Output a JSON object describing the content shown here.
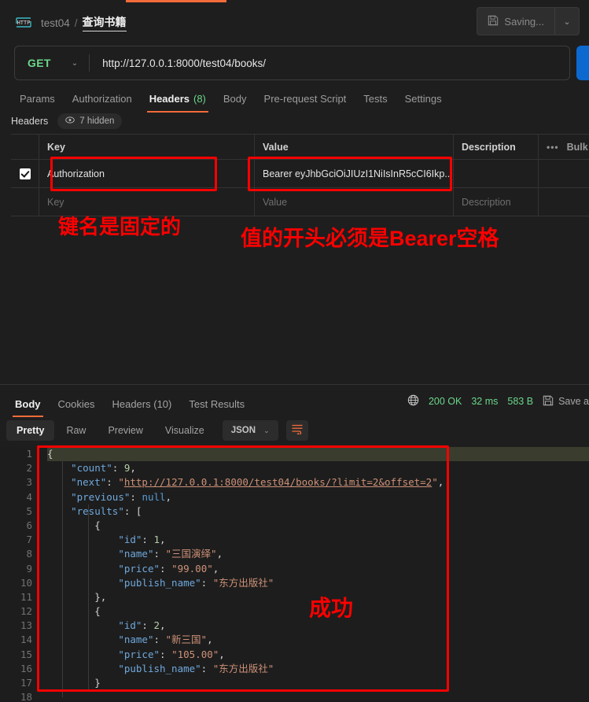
{
  "breadcrumb": {
    "icon": "http-icon",
    "project": "test04",
    "separator": "/",
    "request_name": "查询书籍"
  },
  "save": {
    "icon": "save-disk-icon",
    "label": "Saving...",
    "caret": "⌄"
  },
  "url_bar": {
    "method": "GET",
    "method_caret": "⌄",
    "url": "http://127.0.0.1:8000/test04/books/",
    "send_label": ""
  },
  "request_tabs": [
    {
      "label": "Params",
      "count": "",
      "active": false
    },
    {
      "label": "Authorization",
      "count": "",
      "active": false
    },
    {
      "label": "Headers",
      "count": "(8)",
      "active": true
    },
    {
      "label": "Body",
      "count": "",
      "active": false
    },
    {
      "label": "Pre-request Script",
      "count": "",
      "active": false
    },
    {
      "label": "Tests",
      "count": "",
      "active": false
    },
    {
      "label": "Settings",
      "count": "",
      "active": false
    }
  ],
  "headers_section": {
    "title": "Headers",
    "hidden_icon": "eye-icon",
    "hidden_label": "7 hidden",
    "columns": [
      "Key",
      "Value",
      "Description"
    ],
    "more_icon": "ellipsis-icon",
    "bulk_edit": "Bulk Edit",
    "rows": [
      {
        "checked": true,
        "key": "Authorization",
        "value": "Bearer eyJhbGciOiJIUzI1NiIsInR5cCI6Ikp...",
        "description": ""
      }
    ],
    "placeholder_row": {
      "key": "Key",
      "value": "Value",
      "description": "Description"
    }
  },
  "annotations": [
    {
      "name": "key-name-note",
      "text": "键名是固定的"
    },
    {
      "name": "value-prefix-note",
      "text": "值的开头必须是Bearer空格"
    },
    {
      "name": "success-note",
      "text": "成功"
    }
  ],
  "response_tabs": [
    {
      "label": "Body",
      "count": "",
      "active": true
    },
    {
      "label": "Cookies",
      "count": "",
      "active": false
    },
    {
      "label": "Headers",
      "count": "(10)",
      "active": false
    },
    {
      "label": "Test Results",
      "count": "",
      "active": false
    }
  ],
  "response_meta": {
    "globe_icon": "globe-icon",
    "status": "200 OK",
    "time": "32 ms",
    "size": "583 B",
    "save_icon": "save-disk-icon",
    "save_label": "Save a"
  },
  "viewer": {
    "tabs": [
      {
        "label": "Pretty",
        "active": true
      },
      {
        "label": "Raw",
        "active": false
      },
      {
        "label": "Preview",
        "active": false
      },
      {
        "label": "Visualize",
        "active": false
      }
    ],
    "format": "JSON",
    "format_caret": "⌄",
    "wrap_icon": "word-wrap-icon"
  },
  "response_body": {
    "line_numbers": [
      1,
      2,
      3,
      4,
      5,
      6,
      7,
      8,
      9,
      10,
      11,
      12,
      13,
      14,
      15,
      16,
      17,
      18
    ],
    "json": {
      "count": 9,
      "next": "http://127.0.0.1:8000/test04/books/?limit=2&offset=2",
      "previous": null,
      "results": [
        {
          "id": 1,
          "name": "三国演绎",
          "price": "99.00",
          "publish_name": "东方出版社"
        },
        {
          "id": 2,
          "name": "新三国",
          "price": "105.00",
          "publish_name": "东方出版社"
        }
      ]
    },
    "lines": [
      "{",
      "    \"count\": 9,",
      "    \"next\": \"http://127.0.0.1:8000/test04/books/?limit=2&offset=2\",",
      "    \"previous\": null,",
      "    \"results\": [",
      "        {",
      "            \"id\": 1,",
      "            \"name\": \"三国演绎\",",
      "            \"price\": \"99.00\",",
      "            \"publish_name\": \"东方出版社\"",
      "        },",
      "        {",
      "            \"id\": 2,",
      "            \"name\": \"新三国\",",
      "            \"price\": \"105.00\",",
      "            \"publish_name\": \"东方出版社\"",
      "        }",
      ""
    ]
  },
  "colors": {
    "background": "#1e1e1e",
    "accent_orange": "#f26b3a",
    "accent_blue": "#0b69cf",
    "success_green": "#6bd68a",
    "annotation_red": "#fb0000",
    "panel": "#2c2c2c"
  }
}
